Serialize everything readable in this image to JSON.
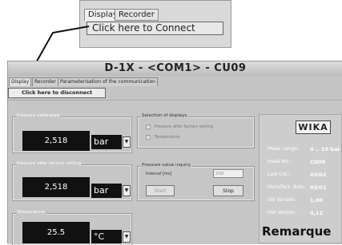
{
  "zoom": {
    "tab_display": "Display",
    "tab_recorder": "Recorder",
    "connect_button": "Click here to Connect"
  },
  "window": {
    "title": "D-1X - <COM1> - CU09",
    "tabs": [
      "Display",
      "Recorder",
      "Parameterisation of the communication"
    ],
    "disconnect_button": "Click here to disconnect"
  },
  "pressure_calibrated": {
    "label": "Pressure calibrated",
    "value": "2,518",
    "unit": "bar"
  },
  "pressure_after_factory": {
    "label": "Pressure after factory setting",
    "value": "2,518",
    "unit": "bar"
  },
  "temperature": {
    "label": "Temperature",
    "value": "25.5",
    "unit": "°C"
  },
  "selection": {
    "label": "Selection of displays",
    "opt1": "Pressure after factory setting",
    "opt2": "Temperature"
  },
  "inquiry": {
    "label": "Pressure value inquiry",
    "interval_label": "Interval [ms]",
    "interval_value": "250",
    "start": "Start",
    "stop": "Stop"
  },
  "info": {
    "logo": "WIKA",
    "rows": [
      {
        "k": "Meas. range:",
        "v": "0 .. 10  bar"
      },
      {
        "k": "Head No.:",
        "v": "CU09"
      },
      {
        "k": "Last Cal.:",
        "v": "03/02"
      },
      {
        "k": "Manufact. date:",
        "v": "03/01"
      },
      {
        "k": "SW Version:",
        "v": "1,00"
      },
      {
        "k": "HW Version:",
        "v": "0,12"
      }
    ]
  },
  "footer_caption": "Remarque",
  "colors": {
    "display_bg": "#111111",
    "panel_bg": "#c6c6c6"
  }
}
